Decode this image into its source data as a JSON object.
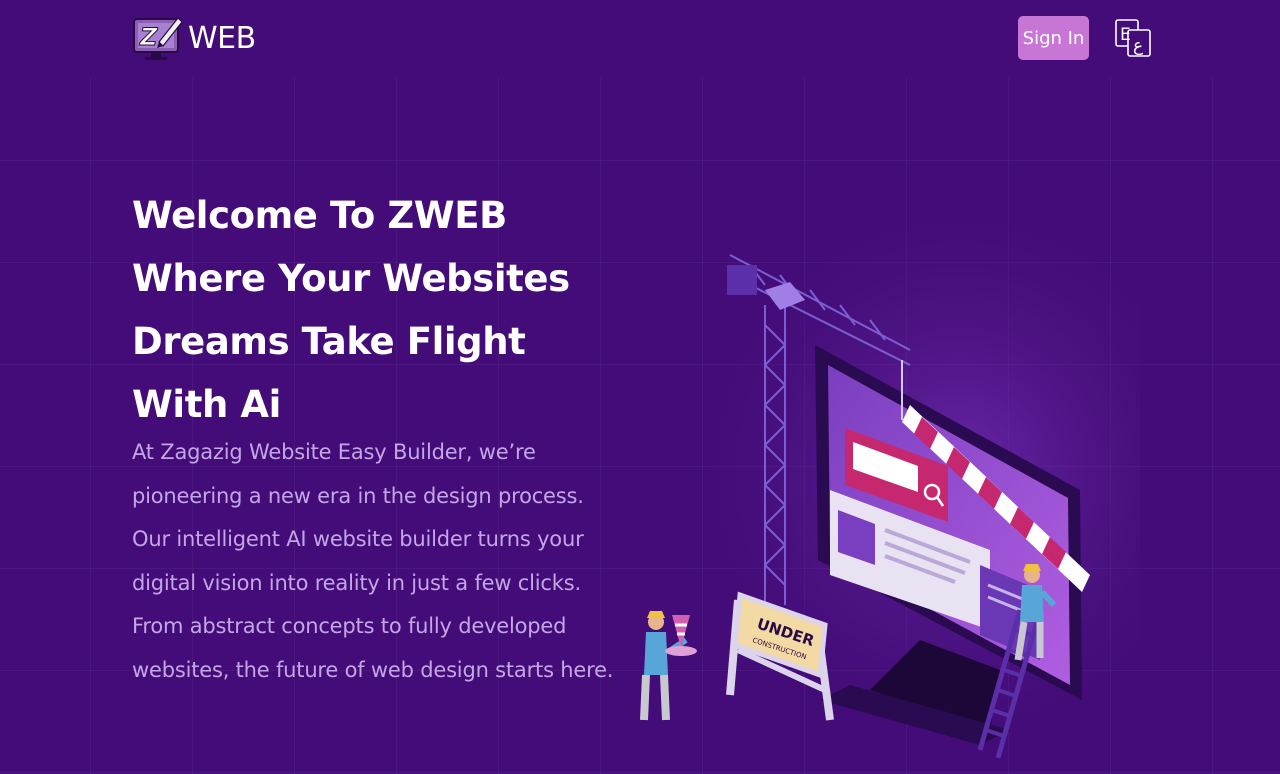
{
  "nav": {
    "logo_text": "WEB",
    "logo_icon": "zweb-logo-icon",
    "signin_label": "Sign In",
    "language_icon": "translate-icon"
  },
  "hero": {
    "title": "Welcome To ZWEB Where Your Websites Dreams Take Flight With Ai",
    "description": "At Zagazig Website Easy Builder, we’re pioneering a new era in the design process. Our intelligent AI website builder turns your digital vision into reality in just a few clicks. From abstract concepts to fully developed websites, the future of web design starts here.",
    "illustration": {
      "sign_line1": "UNDER",
      "sign_line2": "CONSTRUCTION"
    }
  },
  "colors": {
    "background": "#430c78",
    "accent": "#c776d6",
    "description_text": "#c4a6e6"
  }
}
